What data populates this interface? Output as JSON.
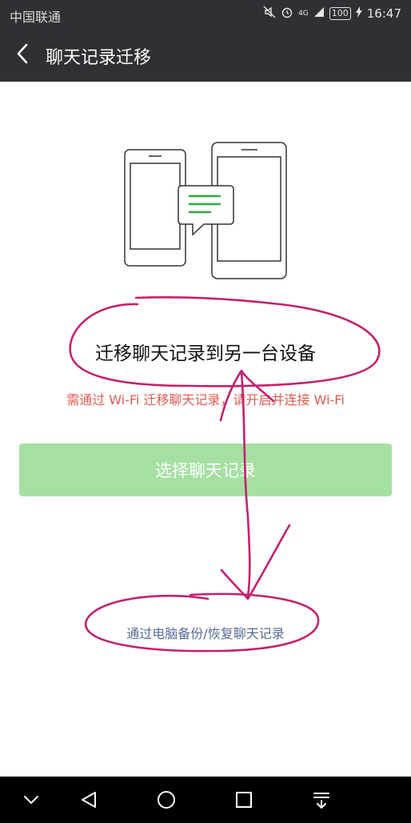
{
  "status_bar": {
    "carrier": "中国联通",
    "network": "4G",
    "battery": "100",
    "time": "16:47",
    "icons": [
      "mute-icon",
      "alarm-icon",
      "signal-icon",
      "charging-icon"
    ]
  },
  "header": {
    "back_icon": "back-icon",
    "title": "聊天记录迁移"
  },
  "main": {
    "illustration_icon": "phones-transfer-icon",
    "headline": "迁移聊天记录到另一台设备",
    "hint": "需通过 Wi-Fi 迁移聊天记录，请开启并连接 Wi-Fi",
    "select_button_label": "选择聊天记录",
    "pc_link": "通过电脑备份/恢复聊天记录"
  },
  "nav_bar": {
    "icons": [
      "hide-nav-icon",
      "back-nav-icon",
      "home-nav-icon",
      "recents-nav-icon",
      "notification-pull-icon"
    ]
  },
  "colors": {
    "bar_bg": "#2f3033",
    "hint_red": "#e05a4e",
    "button_green": "#a5e0a2",
    "link_blue": "#576b95",
    "annotation_magenta": "#c4206e"
  }
}
